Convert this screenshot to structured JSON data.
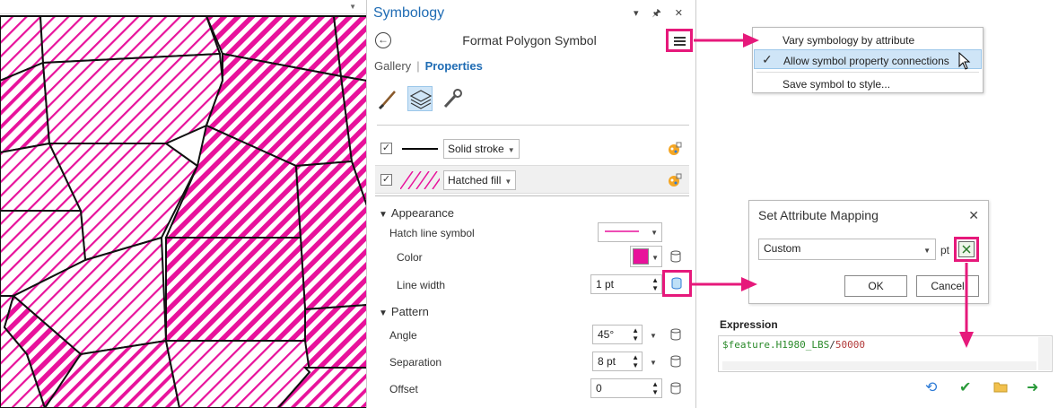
{
  "pane": {
    "title": "Symbology",
    "controls": "▾ 🖈 ✕",
    "format_title": "Format Polygon Symbol",
    "tabs": {
      "gallery": "Gallery",
      "properties": "Properties"
    }
  },
  "layers": [
    {
      "label": "Solid stroke",
      "checked": true
    },
    {
      "label": "Hatched fill",
      "checked": true
    }
  ],
  "appearance": {
    "heading": "Appearance",
    "hatch_label": "Hatch line symbol",
    "color_label": "Color",
    "color_value": "#e8129b",
    "line_width_label": "Line width",
    "line_width_value": "1 pt"
  },
  "pattern": {
    "heading": "Pattern",
    "angle_label": "Angle",
    "angle_value": "45°",
    "separation_label": "Separation",
    "separation_value": "8 pt",
    "offset_label": "Offset",
    "offset_value": "0"
  },
  "context_menu": {
    "items": [
      "Vary symbology by attribute",
      "Allow symbol property connections",
      "Save symbol to style..."
    ],
    "checked_index": 1
  },
  "dialog": {
    "title": "Set Attribute Mapping",
    "combo_value": "Custom",
    "unit": "pt",
    "ok": "OK",
    "cancel": "Cancel"
  },
  "expression": {
    "title": "Expression",
    "field": "$feature.H1980_LBS",
    "op": "/",
    "number": "50000"
  },
  "colors": {
    "accent": "#1f6cb4",
    "highlight": "#e6197b",
    "magenta": "#e8129b"
  }
}
